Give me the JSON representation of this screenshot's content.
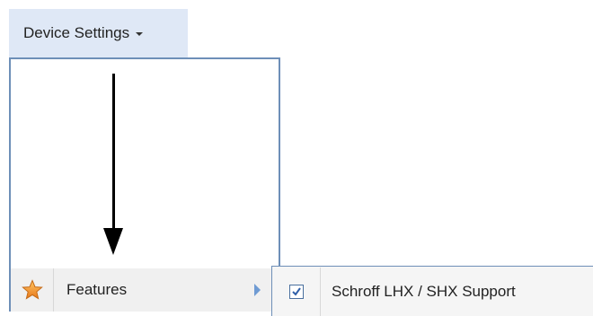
{
  "menu_button": {
    "label": "Device Settings",
    "caret_icon": "caret-down-icon"
  },
  "dropdown": {
    "items": [
      {
        "label": "Features",
        "icon": "star-icon",
        "submenu_icon": "chevron-right-icon"
      }
    ]
  },
  "submenu": {
    "items": [
      {
        "label": "Schroff LHX / SHX Support",
        "checked": true,
        "icon": "checkbox-checked-icon"
      }
    ]
  },
  "annotation": {
    "icon": "down-arrow-icon"
  },
  "colors": {
    "button_bg": "#dfe8f6",
    "menu_border": "#6e8fb8",
    "star_fill": "#f39a2d",
    "submenu_arrow": "#6f9bd3",
    "check_color": "#2f5fa8"
  }
}
